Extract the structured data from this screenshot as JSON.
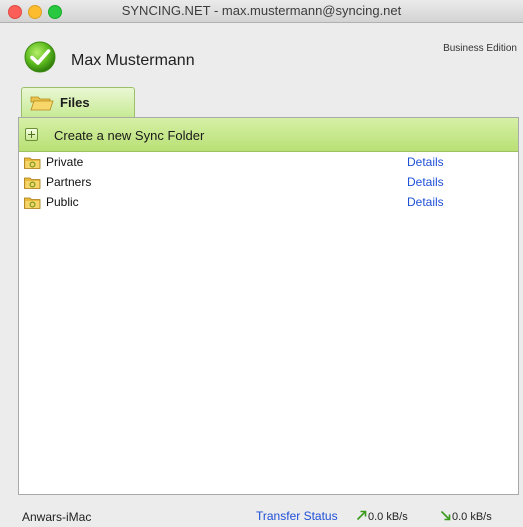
{
  "window": {
    "title": "SYNCING.NET - max.mustermann@syncing.net"
  },
  "header": {
    "username": "Max Mustermann",
    "edition": "Business Edition",
    "status_icon": "green-check-icon"
  },
  "tabs": [
    {
      "label": "Files",
      "icon": "open-folder-icon",
      "active": true
    }
  ],
  "toolbar": {
    "create_label": "Create a new Sync Folder",
    "create_icon": "plus-icon"
  },
  "folders": [
    {
      "name": "Private",
      "details_label": "Details"
    },
    {
      "name": "Partners",
      "details_label": "Details"
    },
    {
      "name": "Public",
      "details_label": "Details"
    }
  ],
  "statusbar": {
    "machine_name": "Anwars-iMac",
    "transfer_status_label": "Transfer Status",
    "upload_rate": "0.0 kB/s",
    "download_rate": "0.0 kB/s"
  },
  "colors": {
    "accent_green": "#c6ea92",
    "link_blue": "#1e4fd8",
    "traffic_red": "#fc5f57",
    "traffic_yellow": "#fdbc2e",
    "traffic_green": "#28c840"
  }
}
